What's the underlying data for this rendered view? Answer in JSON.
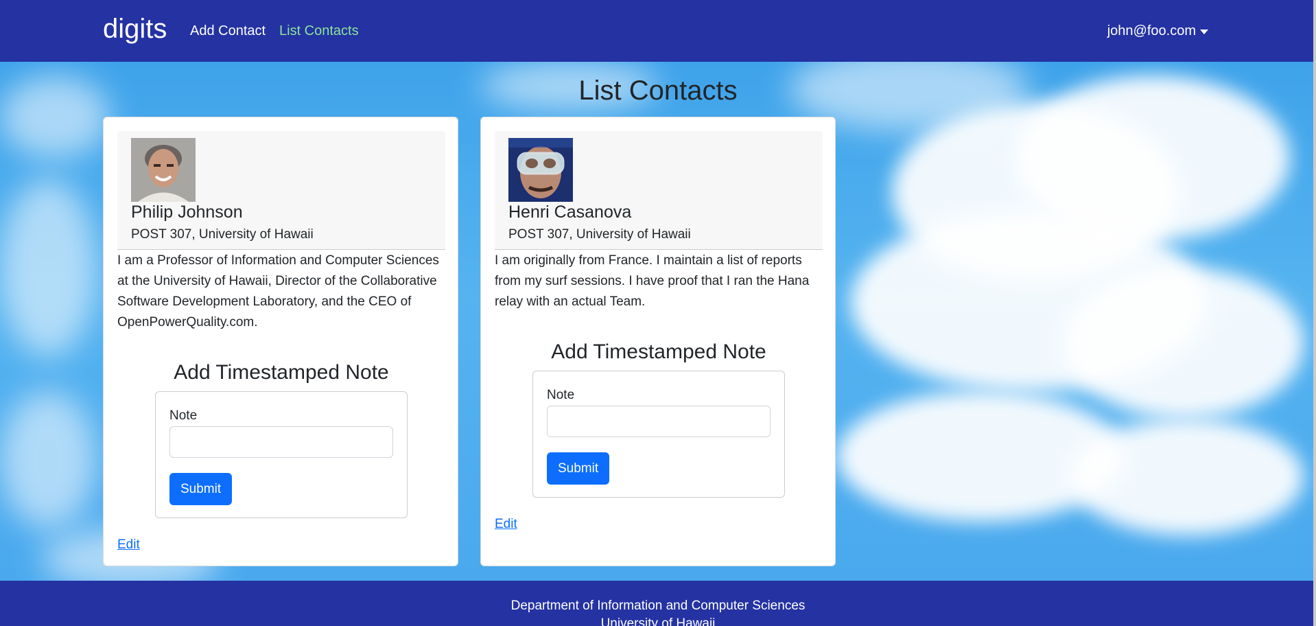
{
  "navbar": {
    "brand": "digits",
    "links": [
      {
        "label": "Add Contact",
        "active": false
      },
      {
        "label": "List Contacts",
        "active": true
      }
    ],
    "user": "john@foo.com"
  },
  "page": {
    "title": "List Contacts"
  },
  "contacts": [
    {
      "name": "Philip Johnson",
      "address": "POST 307, University of Hawaii",
      "description": "I am a Professor of Information and Computer Sciences at the University of Hawaii, Director of the Collaborative Software Development Laboratory, and the CEO of OpenPowerQuality.com.",
      "note_title": "Add Timestamped Note",
      "note_label": "Note",
      "note_value": "",
      "submit_label": "Submit",
      "edit_label": "Edit"
    },
    {
      "name": "Henri Casanova",
      "address": "POST 307, University of Hawaii",
      "description": "I am originally from France. I maintain a list of reports from my surf sessions. I have proof that I ran the Hana relay with an actual Team.",
      "note_title": "Add Timestamped Note",
      "note_label": "Note",
      "note_value": "",
      "submit_label": "Submit",
      "edit_label": "Edit"
    }
  ],
  "footer": {
    "line1": "Department of Information and Computer Sciences",
    "line2": "University of Hawaii"
  },
  "colors": {
    "navbar": "#2432a2",
    "active_link": "#8fe39a",
    "primary": "#0d6efd"
  }
}
